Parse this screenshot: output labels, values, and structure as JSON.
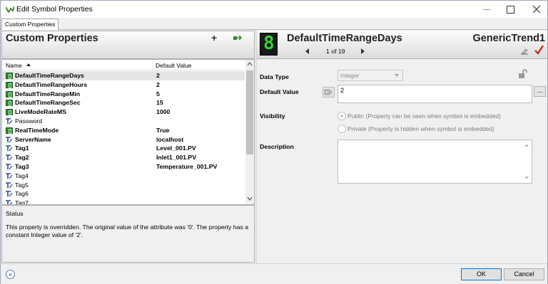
{
  "window": {
    "title": "Edit Symbol Properties"
  },
  "tabs": [
    {
      "label": "Custom Properties"
    }
  ],
  "left": {
    "header": "Custom Properties",
    "add_label": "+",
    "columns": {
      "name": "Name",
      "default_value": "Default Value"
    },
    "rows": [
      {
        "name": "DefaultTimeRangeDays",
        "value": "2",
        "bold": true,
        "icon": "green-override-icon",
        "selected": true
      },
      {
        "name": "DefaultTimeRangeHours",
        "value": "2",
        "bold": true,
        "icon": "green-override-icon"
      },
      {
        "name": "DefaultTimeRangeMin",
        "value": "5",
        "bold": true,
        "icon": "green-override-icon"
      },
      {
        "name": "DefaultTimeRangeSec",
        "value": "15",
        "bold": true,
        "icon": "green-override-icon"
      },
      {
        "name": "LiveModeRateMS",
        "value": "1000",
        "bold": true,
        "icon": "green-override-icon"
      },
      {
        "name": "Password",
        "value": "",
        "bold": false,
        "icon": "property-icon"
      },
      {
        "name": "RealTimeMode",
        "value": "True",
        "bold": true,
        "icon": "green-override-icon"
      },
      {
        "name": "ServerName",
        "value": "localhost",
        "bold": true,
        "icon": "property-icon"
      },
      {
        "name": "Tag1",
        "value": "Level_001.PV",
        "bold": true,
        "icon": "property-icon"
      },
      {
        "name": "Tag2",
        "value": "Inlet1_001.PV",
        "bold": true,
        "icon": "property-icon"
      },
      {
        "name": "Tag3",
        "value": "Temperature_001.PV",
        "bold": true,
        "icon": "property-icon"
      },
      {
        "name": "Tag4",
        "value": "",
        "bold": false,
        "icon": "property-icon"
      },
      {
        "name": "Tag5",
        "value": "",
        "bold": false,
        "icon": "property-icon"
      },
      {
        "name": "Tag6",
        "value": "",
        "bold": false,
        "icon": "property-icon"
      },
      {
        "name": "Tag7",
        "value": "",
        "bold": false,
        "icon": "property-icon"
      }
    ],
    "status_label": "Status",
    "status_text": "This property is overridden. The original value of the attribute was '0'. The property has a constant Integer value of '2'."
  },
  "right": {
    "symbol_icon_text": "8",
    "property_title": "DefaultTimeRangeDays",
    "page_indicator": "1 of 19",
    "symbol_name": "GenericTrend1",
    "labels": {
      "data_type": "Data Type",
      "default_value": "Default Value",
      "visibility": "Visibility",
      "description": "Description"
    },
    "data_type_value": "Integer",
    "default_value": "2",
    "ellipsis": "...",
    "visibility_options": [
      {
        "label": "Public (Property can be seen when symbol is embedded)",
        "selected": true
      },
      {
        "label": "Private (Property is hidden when symbol is embedded)",
        "selected": false
      }
    ],
    "description": ""
  },
  "footer": {
    "ok": "OK",
    "cancel": "Cancel",
    "collapse_label": "«"
  },
  "colors": {
    "accent_green": "#2f8a2f",
    "accent_red": "#c8201c",
    "focus_blue": "#0078d7"
  }
}
